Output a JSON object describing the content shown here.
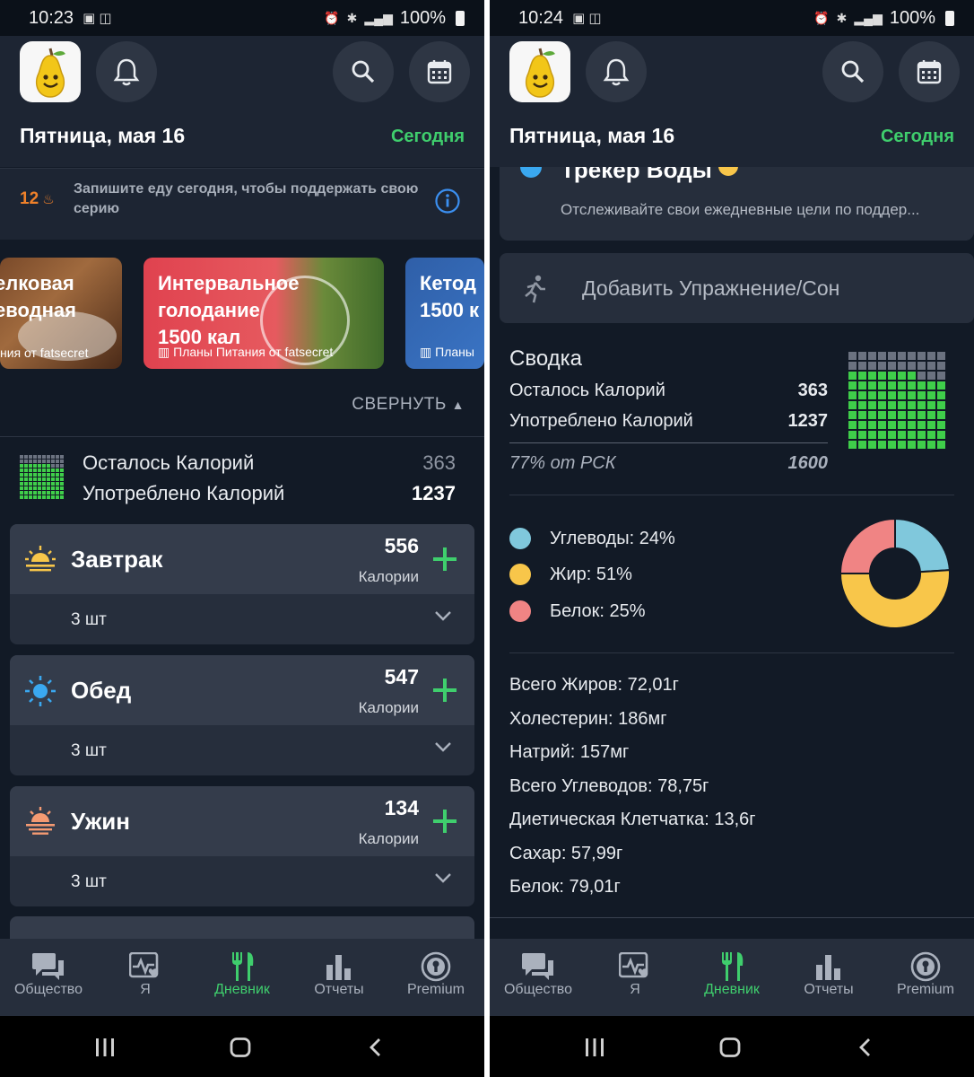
{
  "colors": {
    "accent_green": "#3fce6d",
    "streak_orange": "#f0812a",
    "info_blue": "#3b8ff0",
    "carbs": "#80c8dc",
    "fat": "#f8c64a",
    "protein": "#f08484",
    "calorie_grid_green": "#3fce4a",
    "calorie_grid_gray": "#6b7280"
  },
  "calorie_grid_filled_fraction": 0.77,
  "left": {
    "status": {
      "time": "10:23",
      "battery": "100%"
    },
    "header": {
      "date": "Пятница, мая 16",
      "today": "Сегодня"
    },
    "streak": {
      "count": "12",
      "message": "Запишите еду сегодня, чтобы поддержать свою серию"
    },
    "plans": [
      {
        "title_line1": "елковая",
        "title_line2": "еводная",
        "subtitle": "ния от fatsecret"
      },
      {
        "title_line1": "Интервальное",
        "title_line2": "голодание",
        "title_line3": "1500 кал",
        "subtitle": "Планы Питания от fatsecret"
      },
      {
        "title_line1": "Кетод",
        "title_line2": "1500 к",
        "subtitle": "Планы"
      }
    ],
    "collapse_label": "СВЕРНУТЬ",
    "summary": {
      "remaining_label": "Осталось Калорий",
      "remaining_value": "363",
      "consumed_label": "Употреблено Калорий",
      "consumed_value": "1237"
    },
    "meals": [
      {
        "name": "Завтрак",
        "calories": "556",
        "calories_label": "Калории",
        "count": "3 шт",
        "icon": "sunrise-icon"
      },
      {
        "name": "Обед",
        "calories": "547",
        "calories_label": "Калории",
        "count": "3 шт",
        "icon": "sun-icon"
      },
      {
        "name": "Ужин",
        "calories": "134",
        "calories_label": "Калории",
        "count": "3 шт",
        "icon": "sunset-icon"
      }
    ]
  },
  "right": {
    "status": {
      "time": "10:24",
      "battery": "100%"
    },
    "header": {
      "date": "Пятница, мая 16",
      "today": "Сегодня"
    },
    "water": {
      "title": "Трекер Воды",
      "description": "Отслеживайте свои ежедневные цели по поддер..."
    },
    "exercise_label": "Добавить Упражнение/Сон",
    "summary": {
      "title": "Сводка",
      "remaining_label": "Осталось Калорий",
      "remaining_value": "363",
      "consumed_label": "Употреблено Калорий",
      "consumed_value": "1237",
      "rdi_label": "77% от РСК",
      "rdi_value": "1600"
    },
    "macros": [
      {
        "label": "Углеводы: 24%",
        "percent": 24,
        "key": "carbs"
      },
      {
        "label": "Жир: 51%",
        "percent": 51,
        "key": "fat"
      },
      {
        "label": "Белок: 25%",
        "percent": 25,
        "key": "protein"
      }
    ],
    "nutrients": [
      "Всего Жиров: 72,01г",
      "Холестерин: 186мг",
      "Натрий: 157мг",
      "Всего Углеводов: 78,75г",
      "Диетическая Клетчатка: 13,6г",
      "Сахар: 57,99г",
      "Белок: 79,01г"
    ]
  },
  "nav": [
    {
      "label": "Общество",
      "icon": "community-icon",
      "active": false
    },
    {
      "label": "Я",
      "icon": "me-icon",
      "active": false
    },
    {
      "label": "Дневник",
      "icon": "diary-icon",
      "active": true
    },
    {
      "label": "Отчеты",
      "icon": "reports-icon",
      "active": false
    },
    {
      "label": "Premium",
      "icon": "premium-icon",
      "active": false
    }
  ]
}
